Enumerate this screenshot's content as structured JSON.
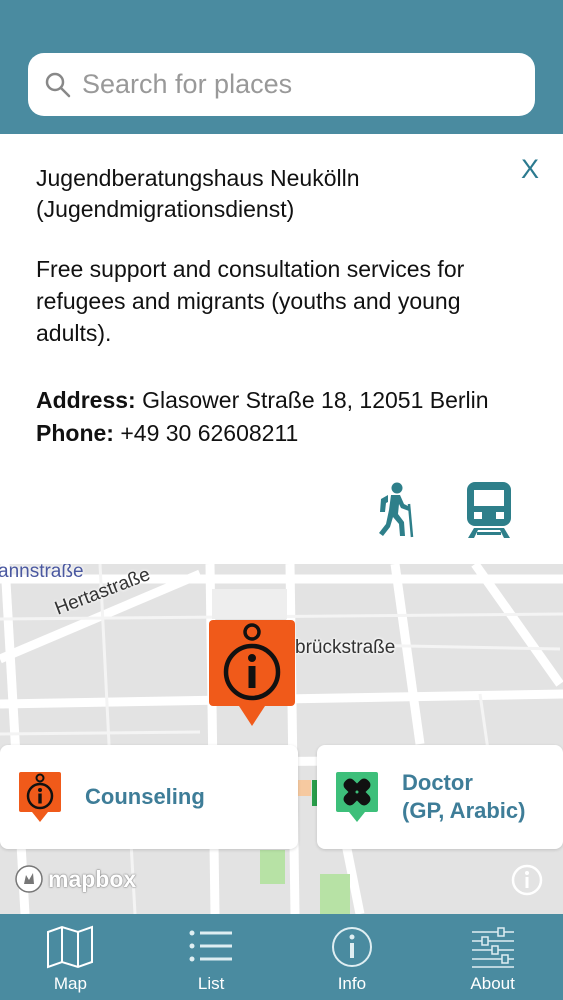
{
  "search": {
    "placeholder": "Search for places"
  },
  "place": {
    "close_label": "X",
    "name": "Jugendberatungshaus Neukölln (Jugendmigrationsdienst)",
    "description": "Free support and consultation services for refugees and migrants (youths and young adults).",
    "address_label": "Address:",
    "address": "Glasower Straße 18, 12051 Berlin",
    "phone_label": "Phone:",
    "phone": "+49 30 62608211"
  },
  "map": {
    "streets": {
      "street_1": "annstraße",
      "street_2": "Hertastraße",
      "street_3": "brückstraße"
    },
    "logo_text": "mapbox",
    "cards": {
      "counseling": "Counseling",
      "doctor_line1": "Doctor",
      "doctor_line2": "(GP, Arabic)"
    }
  },
  "tabs": {
    "map": "Map",
    "list": "List",
    "info": "Info",
    "about": "About"
  },
  "colors": {
    "brand": "#4a8ba0",
    "accent_text": "#3e7d98",
    "marker_orange": "#f05a1a",
    "doctor_green": "#3dbf7a"
  }
}
